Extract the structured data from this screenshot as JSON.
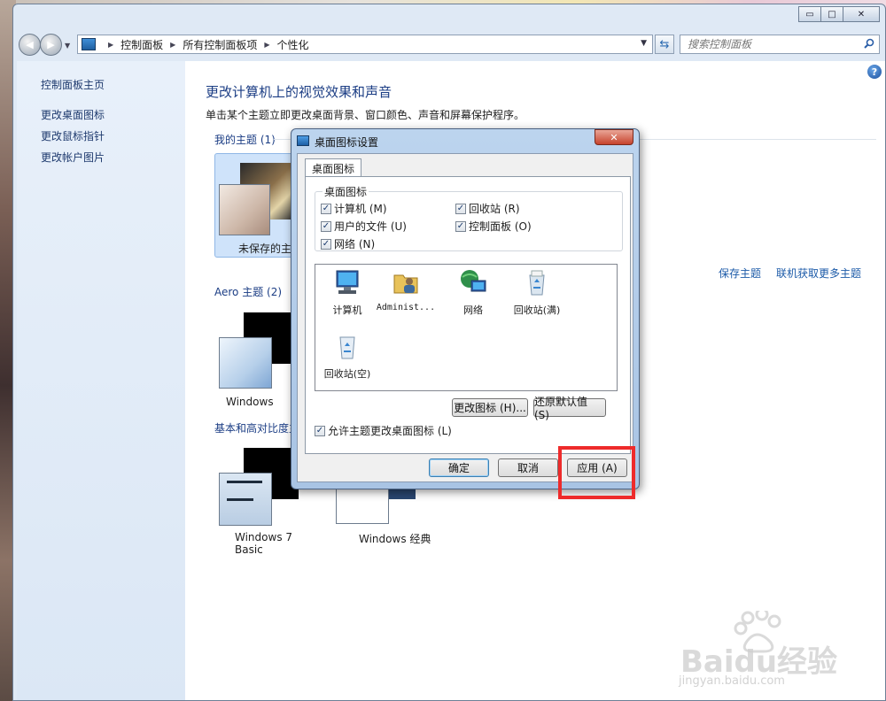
{
  "window": {
    "title_buttons": {
      "minimize": "▭",
      "maximize": "□",
      "close": "✕"
    }
  },
  "nav": {
    "breadcrumbs": [
      "控制面板",
      "所有控制面板项",
      "个性化"
    ],
    "search_placeholder": "搜索控制面板"
  },
  "leftpane": {
    "links": [
      "控制面板主页",
      "更改桌面图标",
      "更改鼠标指针",
      "更改帐户图片"
    ]
  },
  "content": {
    "title": "更改计算机上的视觉效果和声音",
    "description": "单击某个主题立即更改桌面背景、窗口颜色、声音和屏幕保护程序。",
    "groups": {
      "my_themes": "我的主题 (1)",
      "aero_themes": "Aero 主题 (2)",
      "basic_themes": "基本和高对比度主"
    },
    "themes": {
      "unsaved": "未保存的主",
      "aero_windows": "Windows",
      "win7_basic": "Windows 7 Basic",
      "windows_classic": "Windows 经典"
    },
    "links": {
      "save_theme": "保存主题",
      "more_themes": "联机获取更多主题"
    }
  },
  "dialog": {
    "title": "桌面图标设置",
    "tab": "桌面图标",
    "fieldset": "桌面图标",
    "checkboxes": [
      {
        "label": "计算机 (M)",
        "checked": true
      },
      {
        "label": "回收站 (R)",
        "checked": true
      },
      {
        "label": "用户的文件 (U)",
        "checked": true
      },
      {
        "label": "控制面板 (O)",
        "checked": true
      },
      {
        "label": "网络 (N)",
        "checked": true
      }
    ],
    "icons": [
      "计算机",
      "Administ...",
      "网络",
      "回收站(满)",
      "回收站(空)"
    ],
    "change_icon": "更改图标 (H)...",
    "restore_default": "还原默认值 (S)",
    "allow_themes": "允许主题更改桌面图标 (L)",
    "ok": "确定",
    "cancel": "取消",
    "apply": "应用 (A)"
  },
  "watermark": {
    "brand": "Baidu经验",
    "url": "jingyan.baidu.com"
  }
}
